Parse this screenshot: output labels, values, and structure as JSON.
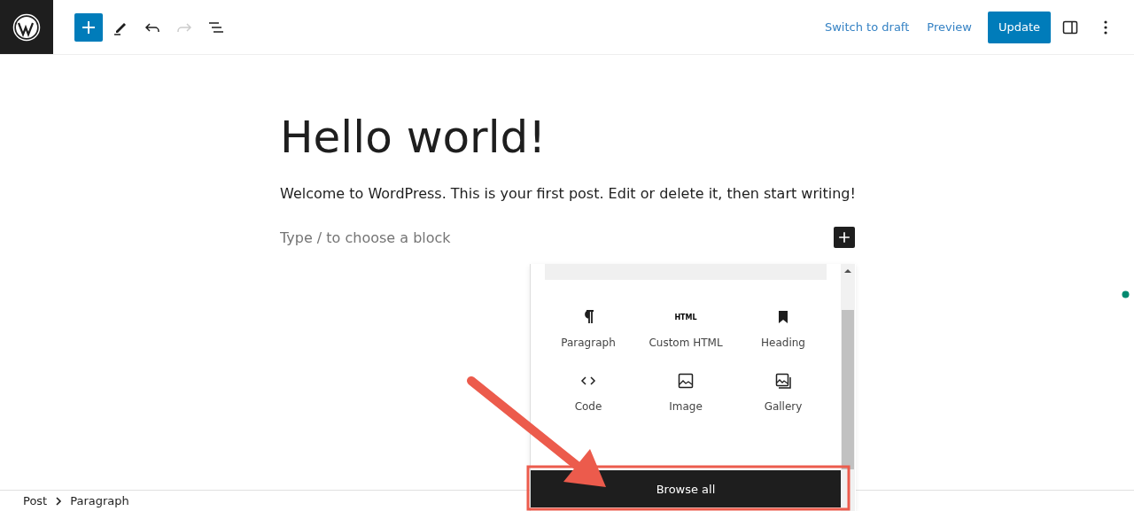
{
  "toolbar": {
    "tools": [
      {
        "kind": "add",
        "selected": true,
        "disabled": false
      },
      {
        "kind": "edit",
        "selected": false,
        "disabled": false
      },
      {
        "kind": "undo",
        "selected": false,
        "disabled": false
      },
      {
        "kind": "redo",
        "selected": false,
        "disabled": true
      },
      {
        "kind": "list",
        "selected": false,
        "disabled": false
      }
    ],
    "actions": [
      {
        "kind": "link",
        "label": "Switch to draft"
      },
      {
        "kind": "link",
        "label": "Preview"
      },
      {
        "kind": "primary",
        "label": "Update"
      }
    ]
  },
  "post": {
    "title": "Hello world!",
    "paragraph": "Welcome to WordPress. This is your first post. Edit or delete it, then start writing!",
    "placeholder": "Type / to choose a block"
  },
  "inserter": {
    "blocks": [
      {
        "kind": "paragraph",
        "label": "Paragraph"
      },
      {
        "kind": "html",
        "label": "Custom HTML",
        "icon_text": "HTML"
      },
      {
        "kind": "heading",
        "label": "Heading"
      },
      {
        "kind": "code",
        "label": "Code"
      },
      {
        "kind": "image",
        "label": "Image"
      },
      {
        "kind": "gallery",
        "label": "Gallery"
      }
    ],
    "button": "Browse all"
  },
  "breadcrumb": [
    "Post",
    "Paragraph"
  ]
}
